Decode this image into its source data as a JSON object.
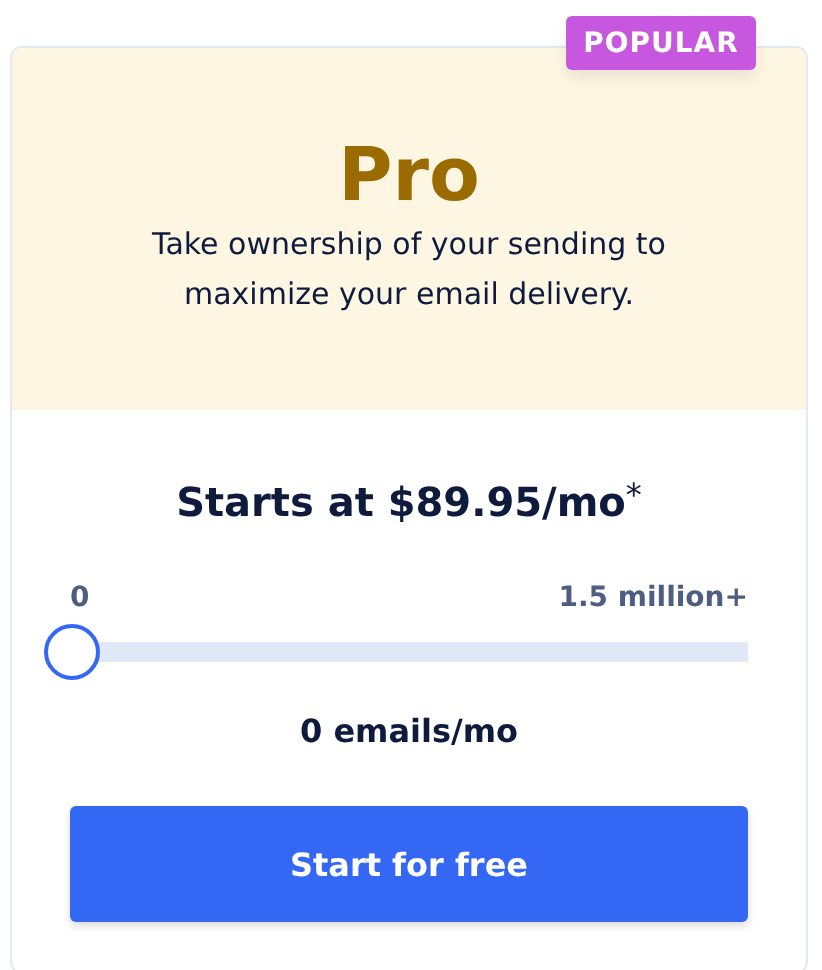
{
  "badge": "POPULAR",
  "plan": {
    "name": "Pro",
    "description": "Take ownership of your sending to maximize your email delivery."
  },
  "price": {
    "text": "Starts at $89.95/mo",
    "footnote": "*"
  },
  "slider": {
    "min_label": "0",
    "max_label": "1.5 million+",
    "level": 0,
    "reading": "0 emails/mo"
  },
  "button": "Start for free"
}
